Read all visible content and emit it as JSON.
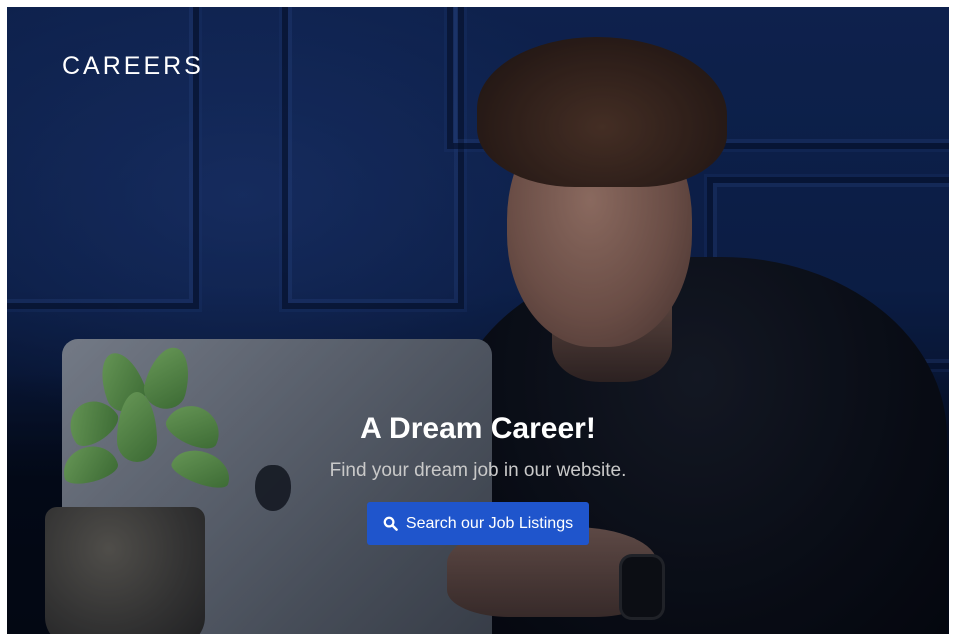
{
  "brand": {
    "label": "CAREERS"
  },
  "hero": {
    "title": "A Dream Career!",
    "subtitle": "Find your dream job in our website.",
    "cta_label": "Search our Job Listings",
    "cta_icon": "search-icon",
    "cta_color": "#1f55cc"
  },
  "background": {
    "image": "photo-man-with-laptop-and-plant",
    "wall_color": "#132a5c"
  }
}
